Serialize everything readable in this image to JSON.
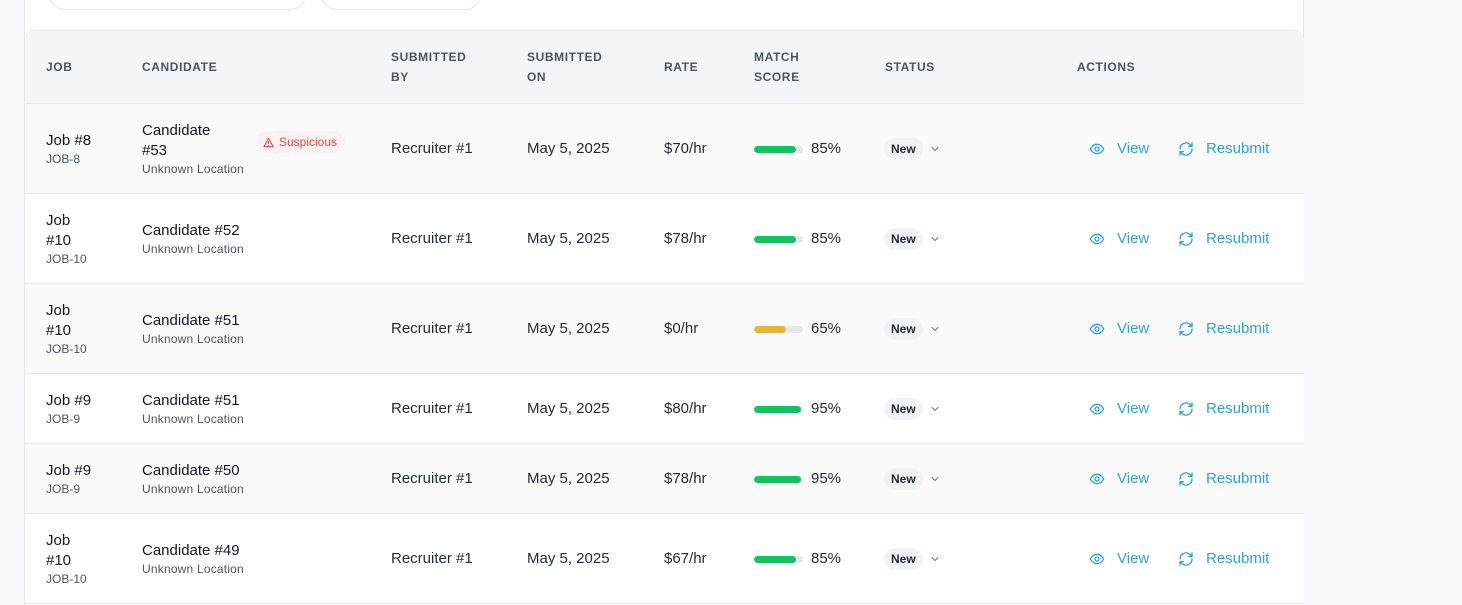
{
  "headers": {
    "job": "JOB",
    "candidate": "CANDIDATE",
    "submitted_by_1": "SUBMITTED",
    "submitted_by_2": "BY",
    "submitted_on_1": "SUBMITTED",
    "submitted_on_2": "ON",
    "rate": "RATE",
    "match_1": "MATCH",
    "match_2": "SCORE",
    "status": "STATUS",
    "actions": "ACTIONS"
  },
  "actions": {
    "view": "View",
    "resubmit": "Resubmit"
  },
  "colors": {
    "accent": "#2ea3d8",
    "good": "#10c55f",
    "medium": "#eab63a",
    "danger": "#ef4444"
  },
  "rows": [
    {
      "job_l1": "Job #8",
      "job_l2": "",
      "job_code": "JOB-8",
      "cand_l1": "Candidate",
      "cand_l2": "#53",
      "location": "Unknown Location",
      "flag": "Suspicious",
      "submitted_by": "Recruiter #1",
      "submitted_on": "May 5, 2025",
      "rate": "$70/hr",
      "score": "85%",
      "score_value": 0.85,
      "status": "New"
    },
    {
      "job_l1": "Job",
      "job_l2": "#10",
      "job_code": "JOB-10",
      "cand_l1": "Candidate #52",
      "cand_l2": "",
      "location": "Unknown Location",
      "submitted_by": "Recruiter #1",
      "submitted_on": "May 5, 2025",
      "rate": "$78/hr",
      "score": "85%",
      "score_value": 0.85,
      "status": "New"
    },
    {
      "job_l1": "Job",
      "job_l2": "#10",
      "job_code": "JOB-10",
      "cand_l1": "Candidate #51",
      "cand_l2": "",
      "location": "Unknown Location",
      "submitted_by": "Recruiter #1",
      "submitted_on": "May 5, 2025",
      "rate": "$0/hr",
      "score": "65%",
      "score_value": 0.65,
      "status": "New"
    },
    {
      "job_l1": "Job #9",
      "job_l2": "",
      "job_code": "JOB-9",
      "cand_l1": "Candidate #51",
      "cand_l2": "",
      "location": "Unknown Location",
      "submitted_by": "Recruiter #1",
      "submitted_on": "May 5, 2025",
      "rate": "$80/hr",
      "score": "95%",
      "score_value": 0.95,
      "status": "New"
    },
    {
      "job_l1": "Job #9",
      "job_l2": "",
      "job_code": "JOB-9",
      "cand_l1": "Candidate #50",
      "cand_l2": "",
      "location": "Unknown Location",
      "submitted_by": "Recruiter #1",
      "submitted_on": "May 5, 2025",
      "rate": "$78/hr",
      "score": "95%",
      "score_value": 0.95,
      "status": "New"
    },
    {
      "job_l1": "Job",
      "job_l2": "#10",
      "job_code": "JOB-10",
      "cand_l1": "Candidate #49",
      "cand_l2": "",
      "location": "Unknown Location",
      "submitted_by": "Recruiter #1",
      "submitted_on": "May 5, 2025",
      "rate": "$67/hr",
      "score": "85%",
      "score_value": 0.85,
      "status": "New"
    }
  ]
}
